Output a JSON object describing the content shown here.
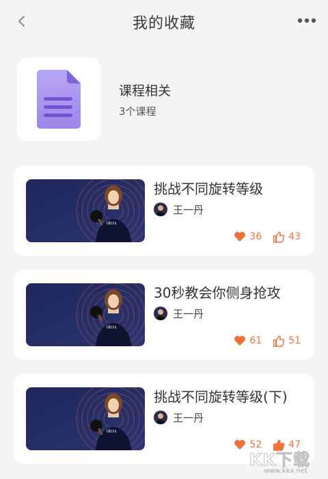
{
  "header": {
    "title": "我的收藏",
    "back_icon": "chevron-left-icon",
    "more_icon": "more-horizontal-icon"
  },
  "category": {
    "icon": "document-icon",
    "title": "课程相关",
    "count_text": "3个课程"
  },
  "courses": [
    {
      "title": "挑战不同旋转等级",
      "author": "王一丹",
      "likes": "36",
      "thumbs": "43"
    },
    {
      "title": "30秒教会你侧身抢攻",
      "author": "王一丹",
      "likes": "61",
      "thumbs": "51"
    },
    {
      "title": "挑战不同旋转等级(下)",
      "author": "王一丹",
      "likes": "52",
      "thumbs": "47"
    }
  ],
  "watermark": {
    "text": "KK下载",
    "url": "www.kkx.net"
  },
  "colors": {
    "accent": "#f2733a",
    "background": "#f4f4f6",
    "thumbnail_bg": "#1f2a5a"
  }
}
